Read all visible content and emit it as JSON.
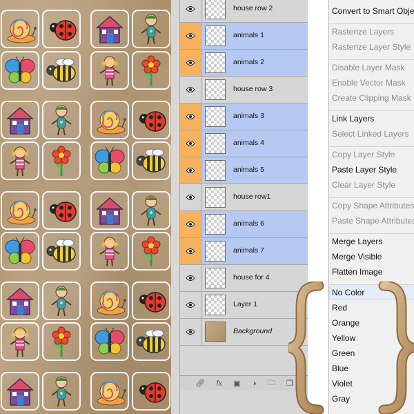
{
  "canvas": {
    "tiles": [
      {
        "icon": "snail-icon",
        "col": 0,
        "row": 0
      },
      {
        "icon": "ladybug-icon",
        "col": 1,
        "row": 0
      },
      {
        "icon": "house-icon",
        "col": 2,
        "row": 0
      },
      {
        "icon": "boy-icon",
        "col": 3,
        "row": 0
      },
      {
        "icon": "butterfly-icon",
        "col": 0,
        "row": 1
      },
      {
        "icon": "bee-icon",
        "col": 1,
        "row": 1
      },
      {
        "icon": "girl-icon",
        "col": 2,
        "row": 1
      },
      {
        "icon": "flower-icon",
        "col": 3,
        "row": 1
      },
      {
        "icon": "house-icon",
        "col": 0,
        "row": 2
      },
      {
        "icon": "boy-icon",
        "col": 1,
        "row": 2
      },
      {
        "icon": "snail-icon",
        "col": 2,
        "row": 2
      },
      {
        "icon": "ladybug-icon",
        "col": 3,
        "row": 2
      },
      {
        "icon": "girl-icon",
        "col": 0,
        "row": 3
      },
      {
        "icon": "flower-icon",
        "col": 1,
        "row": 3
      },
      {
        "icon": "butterfly-icon",
        "col": 2,
        "row": 3
      },
      {
        "icon": "bee-icon",
        "col": 3,
        "row": 3
      },
      {
        "icon": "snail-icon",
        "col": 0,
        "row": 4
      },
      {
        "icon": "ladybug-icon",
        "col": 1,
        "row": 4
      },
      {
        "icon": "house-icon",
        "col": 2,
        "row": 4
      },
      {
        "icon": "boy-icon",
        "col": 3,
        "row": 4
      },
      {
        "icon": "butterfly-icon",
        "col": 0,
        "row": 5
      },
      {
        "icon": "bee-icon",
        "col": 1,
        "row": 5
      },
      {
        "icon": "girl-icon",
        "col": 2,
        "row": 5
      },
      {
        "icon": "flower-icon",
        "col": 3,
        "row": 5
      },
      {
        "icon": "house-icon",
        "col": 0,
        "row": 6
      },
      {
        "icon": "boy-icon",
        "col": 1,
        "row": 6
      },
      {
        "icon": "snail-icon",
        "col": 2,
        "row": 6
      },
      {
        "icon": "ladybug-icon",
        "col": 3,
        "row": 6
      },
      {
        "icon": "girl-icon",
        "col": 0,
        "row": 7
      },
      {
        "icon": "flower-icon",
        "col": 1,
        "row": 7
      },
      {
        "icon": "butterfly-icon",
        "col": 2,
        "row": 7
      },
      {
        "icon": "bee-icon",
        "col": 3,
        "row": 7
      },
      {
        "icon": "house-icon",
        "col": 0,
        "row": 8
      },
      {
        "icon": "boy-icon",
        "col": 1,
        "row": 8
      },
      {
        "icon": "snail-icon",
        "col": 2,
        "row": 8
      },
      {
        "icon": "ladybug-icon",
        "col": 3,
        "row": 8
      }
    ]
  },
  "layers": {
    "items": [
      {
        "name": "house row 2",
        "selected": false
      },
      {
        "name": "animals 1",
        "selected": true
      },
      {
        "name": "animals 2",
        "selected": true
      },
      {
        "name": "house row 3",
        "selected": false
      },
      {
        "name": "animals 3",
        "selected": true
      },
      {
        "name": "animals 4",
        "selected": true
      },
      {
        "name": "animals 5",
        "selected": true
      },
      {
        "name": "house row1",
        "selected": false
      },
      {
        "name": "animals 6",
        "selected": true
      },
      {
        "name": "animals 7",
        "selected": true
      },
      {
        "name": "house for 4",
        "selected": false
      },
      {
        "name": "Layer 1",
        "selected": false
      },
      {
        "name": "Background",
        "selected": false,
        "italic": true,
        "paper": true
      }
    ],
    "footer_icons": [
      "link-icon",
      "fx-icon",
      "mask-icon",
      "adjustment-icon",
      "folder-icon",
      "new-layer-icon"
    ],
    "fx_label": "fx"
  },
  "menu": {
    "items": [
      {
        "label": "Convert to Smart Object",
        "enabled": true
      },
      {
        "sep": true
      },
      {
        "label": "Rasterize Layers",
        "enabled": false
      },
      {
        "label": "Rasterize Layer Style",
        "enabled": false
      },
      {
        "sep": true
      },
      {
        "label": "Disable Layer Mask",
        "enabled": false
      },
      {
        "label": "Enable Vector Mask",
        "enabled": false
      },
      {
        "label": "Create Clipping Mask",
        "enabled": false
      },
      {
        "sep": true
      },
      {
        "label": "Link Layers",
        "enabled": true
      },
      {
        "label": "Select Linked Layers",
        "enabled": false
      },
      {
        "sep": true
      },
      {
        "label": "Copy Layer Style",
        "enabled": false
      },
      {
        "label": "Paste Layer Style",
        "enabled": true
      },
      {
        "label": "Clear Layer Style",
        "enabled": false
      },
      {
        "sep": true
      },
      {
        "label": "Copy Shape Attributes",
        "enabled": false
      },
      {
        "label": "Paste Shape Attributes",
        "enabled": false
      },
      {
        "sep": true
      },
      {
        "label": "Merge Layers",
        "enabled": true
      },
      {
        "label": "Merge Visible",
        "enabled": true
      },
      {
        "label": "Flatten Image",
        "enabled": true
      },
      {
        "sep": true
      },
      {
        "label": "No Color",
        "enabled": true,
        "hover": true
      },
      {
        "label": "Red",
        "enabled": true
      },
      {
        "label": "Orange",
        "enabled": true
      },
      {
        "label": "Yellow",
        "enabled": true
      },
      {
        "label": "Green",
        "enabled": true
      },
      {
        "label": "Blue",
        "enabled": true
      },
      {
        "label": "Violet",
        "enabled": true
      },
      {
        "label": "Gray",
        "enabled": true
      }
    ]
  },
  "colors": {
    "selected_layer": "#b6c9f2",
    "selected_eye": "#f7b25f",
    "panel": "#d6d6d6",
    "menu_bg": "#f0f0f0",
    "disabled_text": "#8c8c8c",
    "brace_wood": "#c9a77c"
  }
}
